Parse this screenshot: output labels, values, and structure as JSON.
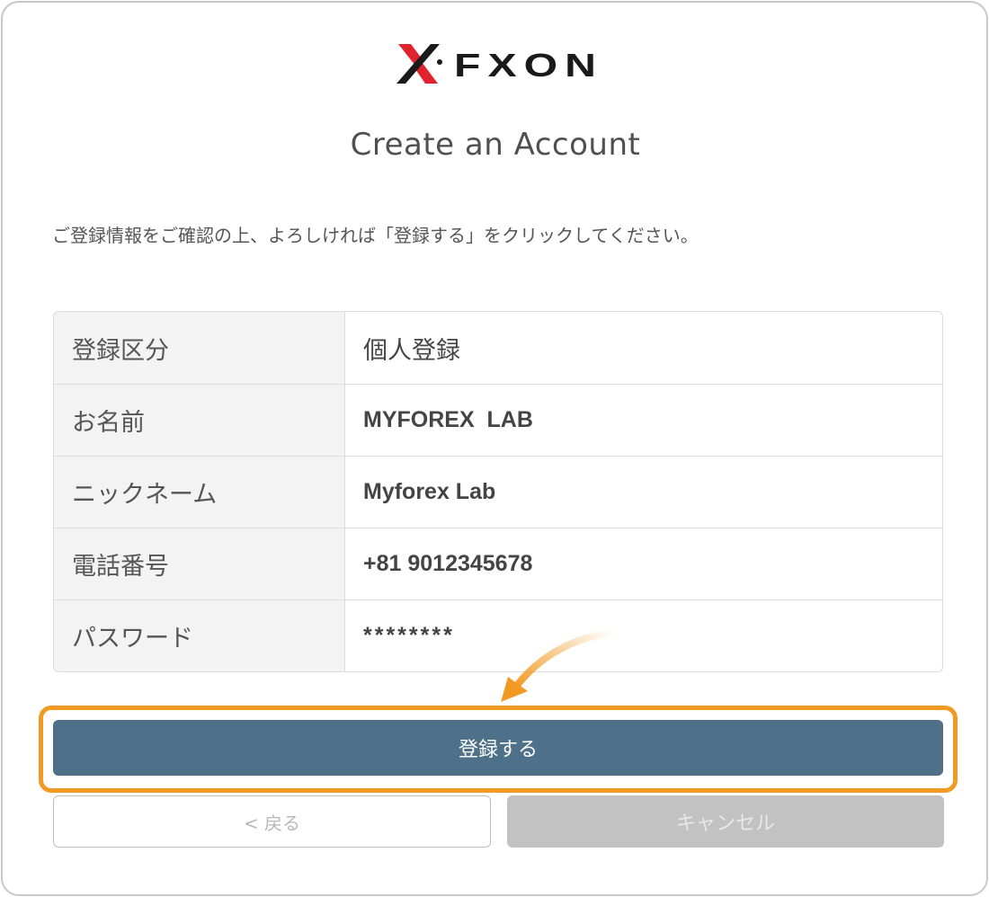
{
  "brand": {
    "logo_text": "FXON",
    "logo_mark_color": "#e0232d"
  },
  "page": {
    "title": "Create an Account",
    "instruction": "ご登録情報をご確認の上、よろしければ「登録する」をクリックしてください。"
  },
  "confirmation": {
    "rows": [
      {
        "label": "登録区分",
        "value": "個人登録"
      },
      {
        "label": "お名前",
        "value": "MYFOREX  LAB"
      },
      {
        "label": "ニックネーム",
        "value": "Myforex Lab"
      },
      {
        "label": "電話番号",
        "value": "+81 9012345678"
      },
      {
        "label": "パスワード",
        "value": "********"
      }
    ]
  },
  "actions": {
    "register_label": "登録する",
    "back_label": "< 戻る",
    "cancel_label": "キャンセル"
  },
  "colors": {
    "primary_button": "#4e7189",
    "highlight": "#f19a23",
    "disabled_button": "#c2c2c2"
  }
}
